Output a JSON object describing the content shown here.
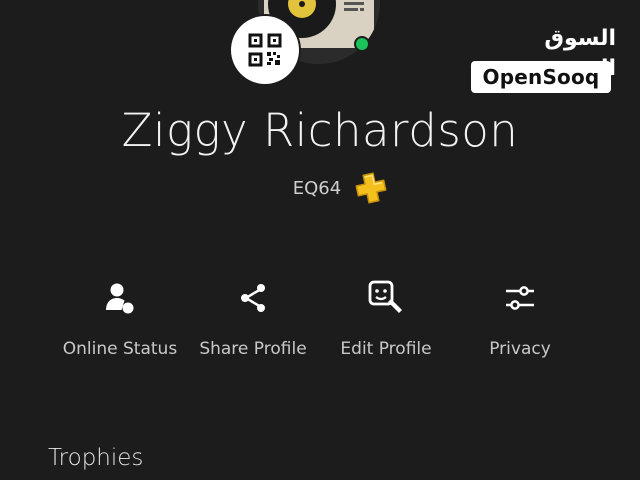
{
  "watermark": {
    "arabic_text": "السوق المفتوح",
    "brand_text": "OpenSooq"
  },
  "profile": {
    "name": "Ziggy Richardson",
    "online_id": "EQ64",
    "online_status": "online",
    "status_color": "#19c35a",
    "membership_icon": "playstation-plus-icon",
    "membership_color": "#f4c01e"
  },
  "actions": [
    {
      "label": "Online Status",
      "icon": "online-status-icon"
    },
    {
      "label": "Share Profile",
      "icon": "share-icon"
    },
    {
      "label": "Edit Profile",
      "icon": "edit-profile-icon"
    },
    {
      "label": "Privacy",
      "icon": "sliders-icon"
    }
  ],
  "sections": {
    "trophies_title": "Trophies"
  },
  "colors": {
    "background": "#1c1c1d",
    "text_primary": "#f2f2f2",
    "text_secondary": "#c9c9c9",
    "qr_button_bg": "#ffffff"
  }
}
